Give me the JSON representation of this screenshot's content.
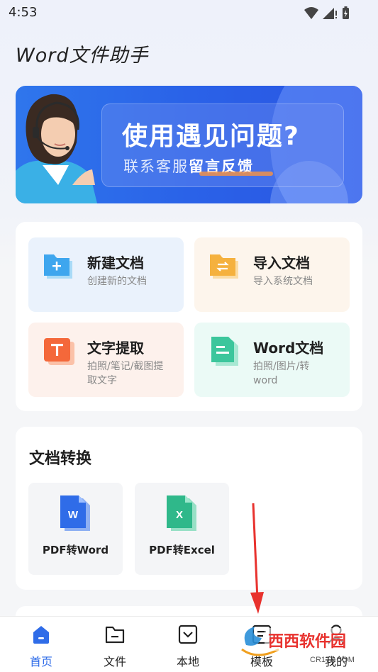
{
  "status_bar": {
    "time": "4:53"
  },
  "app": {
    "title": "Word文件助手"
  },
  "banner": {
    "title": "使用遇见问题?",
    "subtitle_prefix": "联系客服",
    "subtitle_highlight": "留言反馈"
  },
  "tools": [
    {
      "title": "新建文档",
      "desc": "创建新的文档",
      "icon": "new-doc-icon",
      "bg": "#eaf2fc",
      "color": "#3ea6ee"
    },
    {
      "title": "导入文档",
      "desc": "导入系统文档",
      "icon": "import-doc-icon",
      "bg": "#fdf5ec",
      "color": "#f5b13e"
    },
    {
      "title": "文字提取",
      "desc": "拍照/笔记/截图提取文字",
      "icon": "text-extract-icon",
      "bg": "#fdf1ec",
      "color": "#f4683a"
    },
    {
      "title": "Word文档",
      "desc": "拍照/图片/转word",
      "icon": "word-doc-icon",
      "bg": "#ebfaf6",
      "color": "#3cc69c"
    }
  ],
  "conversion": {
    "title": "文档转换",
    "items": [
      {
        "label": "PDF转Word",
        "icon": "pdf-to-word-icon",
        "color": "#2f6ce8",
        "letter": "W"
      },
      {
        "label": "PDF转Excel",
        "icon": "pdf-to-excel-icon",
        "color": "#2fb88a",
        "letter": "X"
      }
    ]
  },
  "nav": [
    {
      "label": "首页",
      "icon": "home-icon",
      "active": true
    },
    {
      "label": "文件",
      "icon": "folder-icon",
      "active": false
    },
    {
      "label": "本地",
      "icon": "local-icon",
      "active": false
    },
    {
      "label": "模板",
      "icon": "template-icon",
      "active": false
    },
    {
      "label": "我的",
      "icon": "profile-icon",
      "active": false
    }
  ],
  "watermark": {
    "text": "西西软件园",
    "sub": "CR173.COM"
  },
  "colors": {
    "accent": "#2f6ce8",
    "arrow": "#e8322e"
  }
}
